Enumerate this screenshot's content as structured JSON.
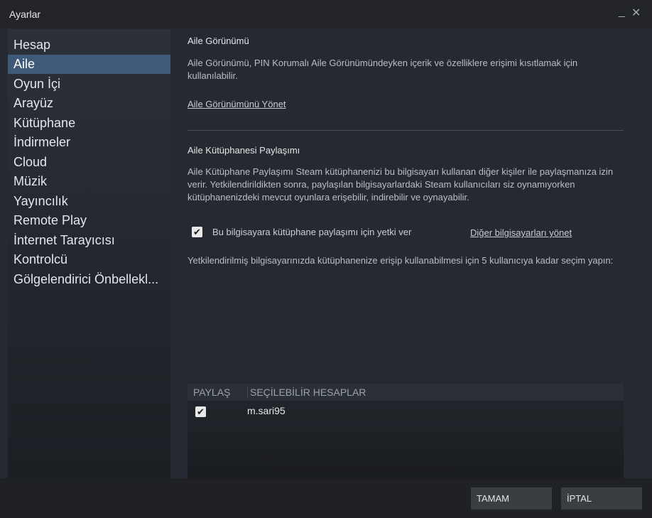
{
  "window": {
    "title": "Ayarlar",
    "minimize": "_",
    "close": "✕"
  },
  "sidebar": {
    "items": [
      {
        "label": "Hesap"
      },
      {
        "label": "Aile"
      },
      {
        "label": "Oyun İçi"
      },
      {
        "label": "Arayüz"
      },
      {
        "label": "Kütüphane"
      },
      {
        "label": "İndirmeler"
      },
      {
        "label": "Cloud"
      },
      {
        "label": "Müzik"
      },
      {
        "label": "Yayıncılık"
      },
      {
        "label": "Remote Play"
      },
      {
        "label": "İnternet Tarayıcısı"
      },
      {
        "label": "Kontrolcü"
      },
      {
        "label": "Gölgelendirici Önbellekl..."
      }
    ],
    "active_index": 1
  },
  "family_view": {
    "heading": "Aile Görünümü",
    "description": "Aile Görünümü, PIN Korumalı Aile Görünümündeyken içerik ve özelliklere erişimi kısıtlamak için kullanılabilir.",
    "manage_link": "Aile Görünümünü Yönet"
  },
  "library_sharing": {
    "heading": "Aile Kütüphanesi Paylaşımı",
    "description": "Aile Kütüphane Paylaşımı Steam kütüphanenizi bu bilgisayarı kullanan diğer kişiler ile paylaşmanıza izin verir. Yetkilendirildikten sonra, paylaşılan bilgisayarlardaki Steam kullanıcıları siz oynamıyorken kütüphanenizdeki mevcut oyunlara erişebilir, indirebilir ve oynayabilir.",
    "authorize_label": "Bu bilgisayara kütüphane paylaşımı için yetki ver",
    "authorize_checked": true,
    "manage_other_link": "Diğer bilgisayarları yönet",
    "select_text": "Yetkilendirilmiş bilgisayarınızda kütüphanenize erişip kullanabilmesi için 5 kullanıcıya kadar seçim yapın:"
  },
  "accounts_table": {
    "columns": [
      "PAYLAŞ",
      "SEÇİLEBİLİR HESAPLAR"
    ],
    "rows": [
      {
        "share": true,
        "account": "m.sari95"
      }
    ]
  },
  "check_glyph": "✔",
  "buttons": {
    "ok": "TAMAM",
    "cancel": "İPTAL"
  }
}
